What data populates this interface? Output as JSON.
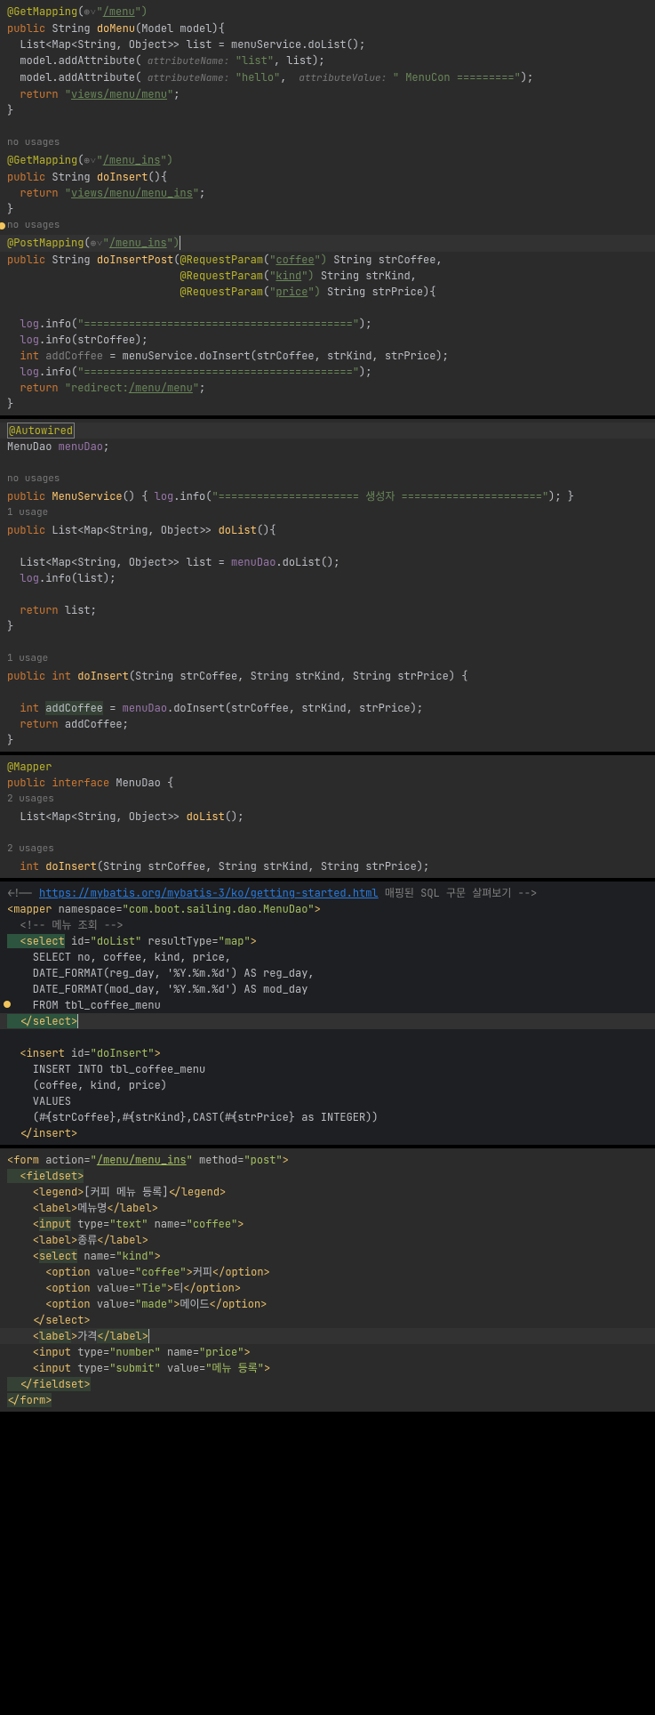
{
  "block1": {
    "l1a": "@GetMapping",
    "l1b": "(",
    "l1icon": "⊕˅",
    "l1c": "\"",
    "l1d": "/menu",
    "l1e": "\")",
    "l2a": "public",
    "l2b": " String ",
    "l2c": "doMenu",
    "l2d": "(Model model){",
    "l3a": "  List<Map<String, Object>> list = menuService.doList();",
    "l4a": "  model.addAttribute(",
    "l4hint": " attributeName: ",
    "l4b": "\"list\"",
    "l4c": ", list);",
    "l5a": "  model.addAttribute(",
    "l5hint1": " attributeName: ",
    "l5b": "\"hello\"",
    "l5c": ", ",
    "l5hint2": " attributeValue: ",
    "l5d": "\" MenuCon =========\"",
    "l5e": ");",
    "l6a": "  return ",
    "l6b": "\"",
    "l6c": "views/menu/menu",
    "l6d": "\"",
    "l6e": ";",
    "l7": "}",
    "hint1": "no usages",
    "l8a": "@GetMapping",
    "l8b": "(",
    "l8c": "\"",
    "l8d": "/menu_ins",
    "l8e": "\")",
    "l9a": "public",
    "l9b": " String ",
    "l9c": "doInsert",
    "l9d": "(){",
    "l10a": "  return ",
    "l10b": "\"",
    "l10c": "views/menu/menu_ins",
    "l10d": "\"",
    "l10e": ";",
    "l11": "}",
    "hint2": "no usages",
    "l12a": "@PostMapping",
    "l12b": "(",
    "l12c": "\"",
    "l12d": "/menu_ins",
    "l12e": "\")",
    "l13a": "public",
    "l13b": " String ",
    "l13c": "doInsertPost",
    "l13d": "(",
    "l13e": "@RequestParam",
    "l13f": "(",
    "l13g": "\"",
    "l13h": "coffee",
    "l13i": "\")",
    "l13j": " String strCoffee,",
    "l14a": "                           ",
    "l14b": "@RequestParam",
    "l14c": "(",
    "l14d": "\"",
    "l14e": "kind",
    "l14f": "\")",
    "l14g": " String strKind,",
    "l15a": "                           ",
    "l15b": "@RequestParam",
    "l15c": "(",
    "l15d": "\"",
    "l15e": "price",
    "l15f": "\")",
    "l15g": " String strPrice){",
    "l16a": "  ",
    "l16b": "log",
    "l16c": ".info(",
    "l16d": "\"==========================================\"",
    "l16e": ");",
    "l17a": "  ",
    "l17b": "log",
    "l17c": ".info(strCoffee);",
    "l18a": "  int ",
    "l18b": "addCoffee",
    "l18c": " = menuService.doInsert(strCoffee, strKind, strPrice);",
    "l19a": "  ",
    "l19b": "log",
    "l19c": ".info(",
    "l19d": "\"==========================================\"",
    "l19e": ");",
    "l20a": "  return ",
    "l20b": "\"redirect:",
    "l20c": "/menu/menu",
    "l20d": "\"",
    "l20e": ";",
    "l21": "}"
  },
  "block2": {
    "l1": "@Autowired",
    "l2a": "MenuDao ",
    "l2b": "menuDao",
    "l2c": ";",
    "hint1": "no usages",
    "l3a": "public ",
    "l3b": "MenuService",
    "l3c": "() { ",
    "l3d": "log",
    "l3e": ".info(",
    "l3f": "\"====================== 생성자 ======================\"",
    "l3g": "); }",
    "hint2": "1 usage",
    "l4a": "public ",
    "l4b": "List<Map<String, Object>> ",
    "l4c": "doList",
    "l4d": "(){",
    "l5a": "  List<Map<String, Object>> list = ",
    "l5b": "menuDao",
    "l5c": ".doList();",
    "l6a": "  ",
    "l6b": "log",
    "l6c": ".info(list);",
    "l7a": "  return ",
    "l7b": "list;",
    "l8": "}",
    "hint3": "1 usage",
    "l9a": "public int ",
    "l9b": "doInsert",
    "l9c": "(String strCoffee, String strKind, String strPrice) {",
    "l10a": "  int ",
    "l10b": "addCoffee",
    "l10c": " = ",
    "l10d": "menuDao",
    "l10e": ".doInsert(strCoffee, strKind, strPrice);",
    "l11a": "  return ",
    "l11b": "addCoffee;",
    "l12": "}"
  },
  "block3": {
    "l1": "@Mapper",
    "l2a": "public interface ",
    "l2b": "MenuDao",
    "l2c": " {",
    "hint1": "2 usages",
    "l3a": "  List<Map<String, Object>> ",
    "l3b": "doList",
    "l3c": "();",
    "hint2": "2 usages",
    "l4a": "  int ",
    "l4b": "doInsert",
    "l4c": "(String strCoffee, String strKind, String strPrice);"
  },
  "block4": {
    "l1a": "<!-- ",
    "l1b": "https://mybatis.org/mybatis-3/ko/getting-started.html",
    "l1c": " 매핑된 SQL 구문 살펴보기 -->",
    "l2a": "<mapper ",
    "l2b": "namespace=",
    "l2c": "\"com.boot.sailing.dao.MenuDao\"",
    "l2d": ">",
    "l3": "  <!-- 메뉴 조회 -->",
    "l4a": "  <select ",
    "l4b": "id=",
    "l4c": "\"doList\"",
    "l4d": " resultType=",
    "l4e": "\"map\"",
    "l4f": ">",
    "l5": "    SELECT no, coffee, kind, price,",
    "l6": "    DATE_FORMAT(reg_day, '%Y.%m.%d') AS reg_day,",
    "l7": "    DATE_FORMAT(mod_day, '%Y.%m.%d') AS mod_day",
    "l8": "    FROM tbl_coffee_menu",
    "l9a": "  </select>",
    "l10a": "  <insert ",
    "l10b": "id=",
    "l10c": "\"doInsert\"",
    "l10d": ">",
    "l11": "    INSERT INTO tbl_coffee_menu",
    "l12": "    (coffee, kind, price)",
    "l13": "    VALUES",
    "l14": "    (#{strCoffee},#{strKind},CAST(#{strPrice} as INTEGER))",
    "l15a": "  </insert>"
  },
  "block5": {
    "l1a": "<form ",
    "l1b": "action=",
    "l1c": "\"",
    "l1d": "/menu/menu_ins",
    "l1e": "\"",
    "l1f": " method=",
    "l1g": "\"post\"",
    "l1h": ">",
    "l2a": "  <fieldset>",
    "l3a": "    <legend>",
    "l3b": "[커피 메뉴 등록]",
    "l3c": "</legend>",
    "l4a": "    <label>",
    "l4b": "메뉴명",
    "l4c": "</label>",
    "l5a": "    <",
    "l5b": "input",
    "l5c": " type=",
    "l5d": "\"text\"",
    "l5e": " name=",
    "l5f": "\"coffee\"",
    "l5g": ">",
    "l6a": "    <label>",
    "l6b": "종류",
    "l6c": "</label>",
    "l7a": "    <",
    "l7b": "select",
    "l7c": " name=",
    "l7d": "\"kind\"",
    "l7e": ">",
    "l8a": "      <option ",
    "l8b": "value=",
    "l8c": "\"coffee\"",
    "l8d": ">",
    "l8e": "커피",
    "l8f": "</option>",
    "l9a": "      <option ",
    "l9b": "value=",
    "l9c": "\"Tie\"",
    "l9d": ">",
    "l9e": "티",
    "l9f": "</option>",
    "l10a": "      <option ",
    "l10b": "value=",
    "l10c": "\"made\"",
    "l10d": ">",
    "l10e": "메이드",
    "l10f": "</option>",
    "l11a": "    </select>",
    "l12a": "    <",
    "l12b": "label",
    "l12c": ">",
    "l12d": "가격",
    "l12e": "</label>",
    "l13a": "    <input ",
    "l13b": "type=",
    "l13c": "\"number\"",
    "l13d": " name=",
    "l13e": "\"price\"",
    "l13f": ">",
    "l14a": "    <input ",
    "l14b": "type=",
    "l14c": "\"submit\"",
    "l14d": " value=",
    "l14e": "\"메뉴 등록\"",
    "l14f": ">",
    "l15a": "  </fieldset>",
    "l16a": "</form>"
  }
}
